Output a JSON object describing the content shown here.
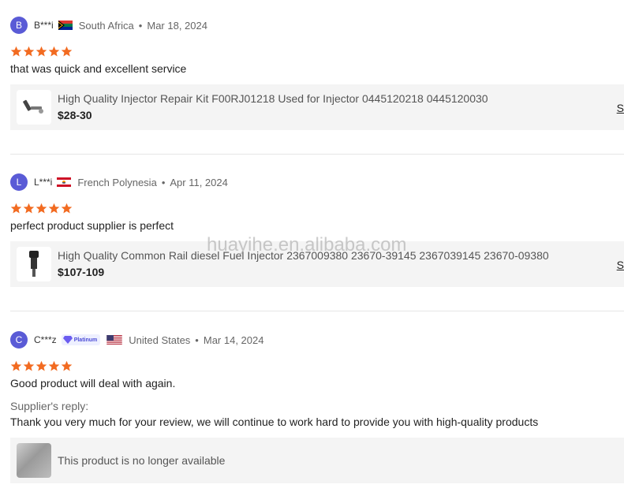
{
  "reviews": [
    {
      "avatar_letter": "B",
      "username": "B***i",
      "country": "South Africa",
      "date": "Mar 18, 2024",
      "rating": 5,
      "text": "that was quick and excellent service",
      "product": {
        "title": "High Quality Injector Repair Kit F00RJ01218 Used for Injector 0445120218 0445120030",
        "price": "$28-30",
        "link": "S"
      }
    },
    {
      "avatar_letter": "L",
      "username": "L***i",
      "country": "French Polynesia",
      "date": "Apr 11, 2024",
      "rating": 5,
      "text": "perfect product supplier is perfect",
      "product": {
        "title": "High Quality Common Rail diesel Fuel Injector 2367009380 23670-39145 2367039145 23670-09380",
        "price": "$107-109",
        "link": "S"
      }
    },
    {
      "avatar_letter": "C",
      "username": "C***z",
      "badge": "Platinum",
      "country": "United States",
      "date": "Mar 14, 2024",
      "rating": 5,
      "text": "Good product will deal with again.",
      "reply_label": "Supplier's reply:",
      "reply_text": "Thank you very much for your review, we will continue to work hard to provide you with high-quality products",
      "product": {
        "unavailable": "This product is no longer available"
      }
    }
  ],
  "dot": "•",
  "watermark": "huayihe.en.alibaba.com",
  "colors": {
    "avatar": "#5a5bd6",
    "star": "#f26b21",
    "product_bg": "#f4f4f4"
  }
}
